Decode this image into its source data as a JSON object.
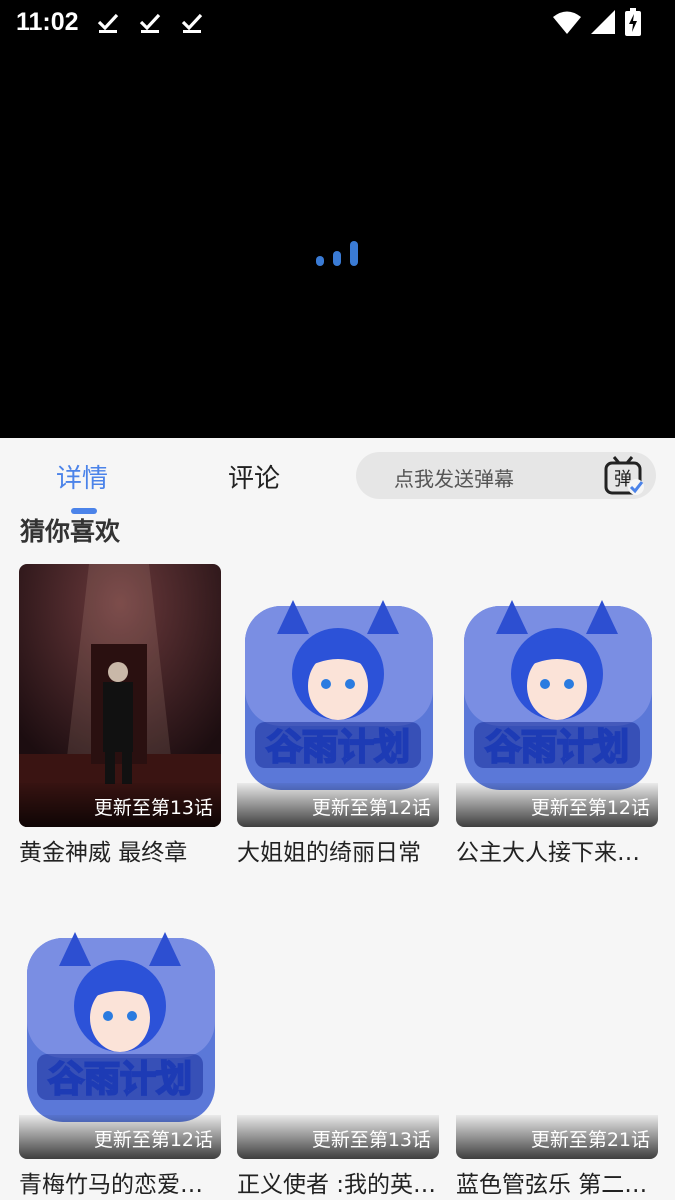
{
  "status_bar": {
    "time": "11:02"
  },
  "tabs": {
    "details": "详情",
    "comments": "评论"
  },
  "danmaku": {
    "placeholder": "点我发送弹幕",
    "icon_text": "弹"
  },
  "recommend": {
    "title": "猜你喜欢",
    "items": [
      {
        "title": "黄金神威 最终章",
        "badge": "更新至第13话",
        "cover": "throne-illustration"
      },
      {
        "title": "大姐姐的绮丽日常",
        "badge": "更新至第12话",
        "cover": "guyu-logo"
      },
      {
        "title": "公主大人接下来…",
        "badge": "更新至第12话",
        "cover": "guyu-logo"
      },
      {
        "title": "青梅竹马的恋爱…",
        "badge": "更新至第12话",
        "cover": "guyu-logo"
      },
      {
        "title": "正义使者 :我的英…",
        "badge": "更新至第13话",
        "cover": "blank"
      },
      {
        "title": "蓝色管弦乐  第二…",
        "badge": "更新至第21话",
        "cover": "blank"
      }
    ]
  },
  "cover_logo_text": "谷雨计划",
  "colors": {
    "accent": "#4b83e9",
    "player_bg": "#000000",
    "page_bg": "#f6f6f6"
  }
}
